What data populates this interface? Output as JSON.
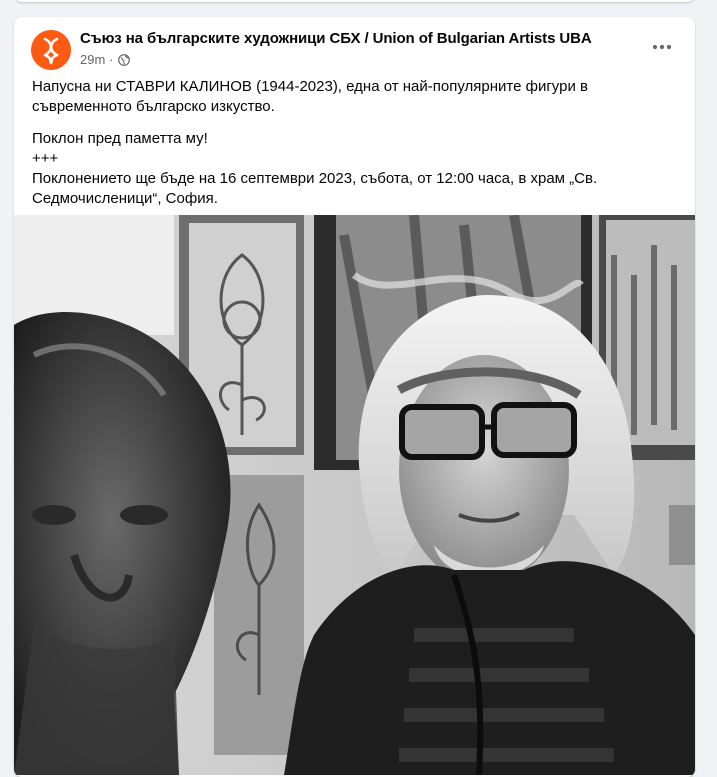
{
  "post": {
    "author": "Съюз на българските художници СБХ / Union of Bulgarian Artists UBA",
    "time": "29m",
    "privacy_icon": "globe-icon",
    "more_icon": "more-horizontal-icon",
    "paragraphs": [
      "Напусна ни СТАВРИ КАЛИНОВ (1944-2023), една от най-популярните фигури в съвременното българско изкуство.",
      "Поклон пред паметта му!",
      "+++",
      "Поклонението ще бъде на 16 септември 2023, събота, от 12:00 часа, в храм „Св. Седмочисленици“, София."
    ]
  },
  "colors": {
    "avatar_bg": "#ff5a14",
    "text": "#050505",
    "secondary_text": "#65676b",
    "background": "#f0f2f5"
  }
}
